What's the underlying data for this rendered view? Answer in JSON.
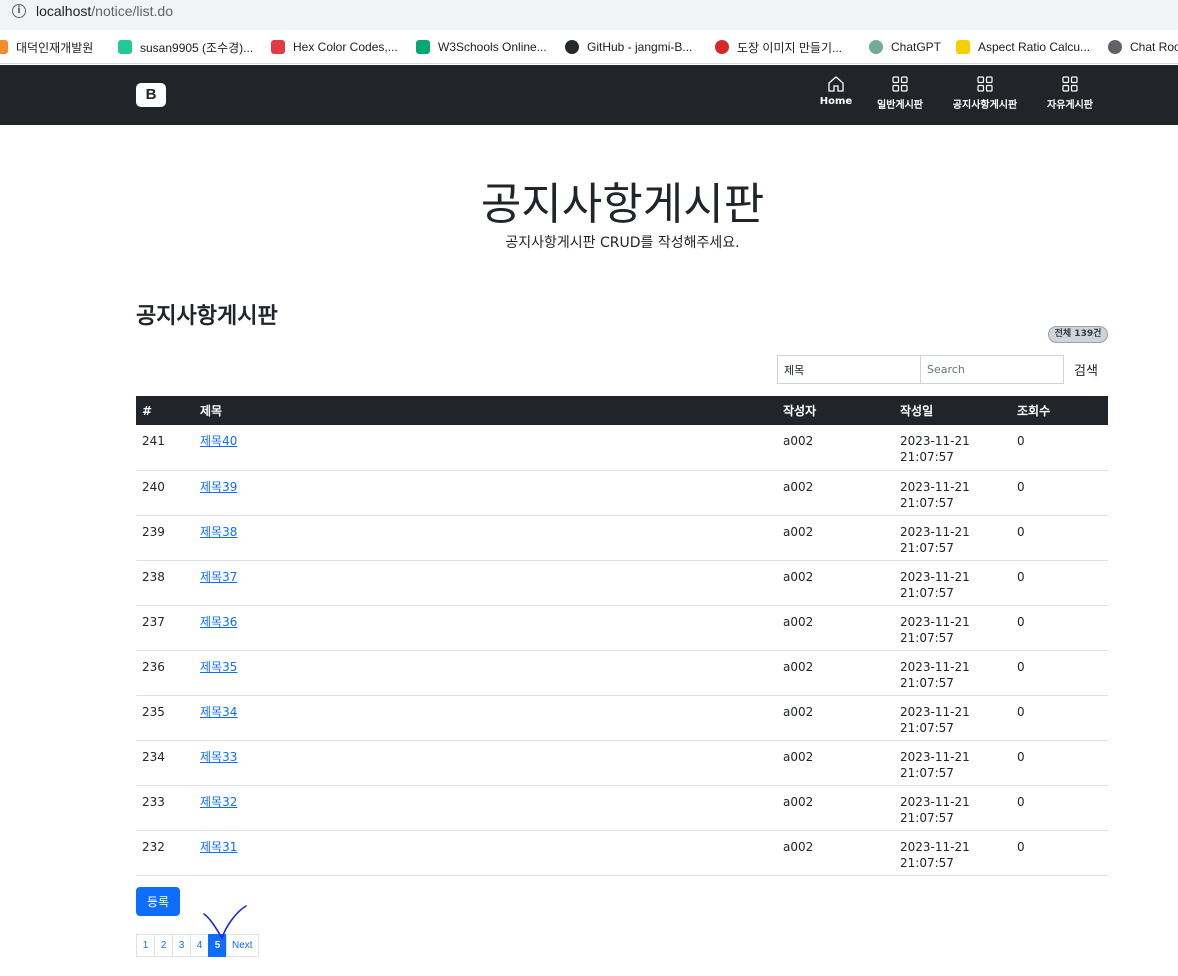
{
  "browser": {
    "url_host": "localhost",
    "url_path": "/notice/list.do",
    "bookmarks": [
      {
        "label": "대덕인재개발원",
        "icon": "ddit-icon",
        "color": "#f28c28"
      },
      {
        "label": "susan9905 (조수경)...",
        "icon": "velog-icon",
        "color": "#20c997"
      },
      {
        "label": "Hex Color Codes,...",
        "icon": "hex-color-icon",
        "color": "#e63946"
      },
      {
        "label": "W3Schools Online...",
        "icon": "w3schools-icon",
        "color": "#04aa6d"
      },
      {
        "label": "GitHub - jangmi-B...",
        "icon": "github-icon",
        "color": "#24292e"
      },
      {
        "label": "도장 이미지 만들기...",
        "icon": "stamp-icon",
        "color": "#d62828"
      },
      {
        "label": "ChatGPT",
        "icon": "chatgpt-icon",
        "color": "#74aa9c"
      },
      {
        "label": "Aspect Ratio Calcu...",
        "icon": "aspect-ratio-icon",
        "color": "#f4d000"
      },
      {
        "label": "Chat Roo",
        "icon": "globe-icon",
        "color": "#5f6368"
      }
    ]
  },
  "navbar": {
    "brand": "B",
    "items": [
      {
        "label": "Home",
        "icon": "home-icon"
      },
      {
        "label": "일반게시판",
        "icon": "grid-icon"
      },
      {
        "label": "공지사항게시판",
        "icon": "grid-icon"
      },
      {
        "label": "자유게시판",
        "icon": "grid-icon"
      }
    ]
  },
  "hero": {
    "title": "공지사항게시판",
    "subtitle": "공지사항게시판 CRUD를 작성해주세요."
  },
  "board": {
    "title": "공지사항게시판",
    "total_badge": "전체 139건",
    "search": {
      "select_value": "제목",
      "placeholder": "Search",
      "button": "검색"
    },
    "columns": [
      "#",
      "제목",
      "작성자",
      "작성일",
      "조회수"
    ],
    "rows": [
      {
        "num": "241",
        "title": "제목40",
        "writer": "a002",
        "date": "2023-11-21",
        "time": "21:07:57",
        "hits": "0"
      },
      {
        "num": "240",
        "title": "제목39",
        "writer": "a002",
        "date": "2023-11-21",
        "time": "21:07:57",
        "hits": "0"
      },
      {
        "num": "239",
        "title": "제목38",
        "writer": "a002",
        "date": "2023-11-21",
        "time": "21:07:57",
        "hits": "0"
      },
      {
        "num": "238",
        "title": "제목37",
        "writer": "a002",
        "date": "2023-11-21",
        "time": "21:07:57",
        "hits": "0"
      },
      {
        "num": "237",
        "title": "제목36",
        "writer": "a002",
        "date": "2023-11-21",
        "time": "21:07:57",
        "hits": "0"
      },
      {
        "num": "236",
        "title": "제목35",
        "writer": "a002",
        "date": "2023-11-21",
        "time": "21:07:57",
        "hits": "0"
      },
      {
        "num": "235",
        "title": "제목34",
        "writer": "a002",
        "date": "2023-11-21",
        "time": "21:07:57",
        "hits": "0"
      },
      {
        "num": "234",
        "title": "제목33",
        "writer": "a002",
        "date": "2023-11-21",
        "time": "21:07:57",
        "hits": "0"
      },
      {
        "num": "233",
        "title": "제목32",
        "writer": "a002",
        "date": "2023-11-21",
        "time": "21:07:57",
        "hits": "0"
      },
      {
        "num": "232",
        "title": "제목31",
        "writer": "a002",
        "date": "2023-11-21",
        "time": "21:07:57",
        "hits": "0"
      }
    ],
    "register_button": "등록",
    "pagination": {
      "pages": [
        "1",
        "2",
        "3",
        "4",
        "5"
      ],
      "active": "5",
      "next": "Next"
    }
  },
  "colors": {
    "navbar_bg": "#212529",
    "primary": "#0d6efd",
    "annotation": "#1a2bd8"
  }
}
